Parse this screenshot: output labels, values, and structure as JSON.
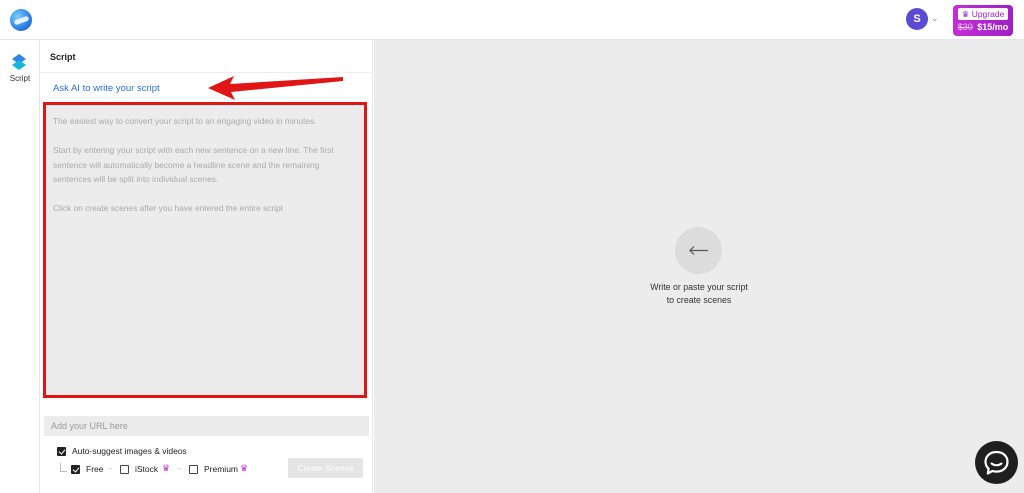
{
  "header": {
    "avatar_initial": "S",
    "upgrade": {
      "label": "Upgrade",
      "old_price": "$30",
      "new_price": "$15/mo",
      "color": "#b62fd0"
    }
  },
  "sidebar": {
    "items": [
      {
        "label": "Script",
        "icon": "script-icon"
      }
    ]
  },
  "script_panel": {
    "title": "Script",
    "ask_ai_link": "Ask AI to write your script",
    "placeholder_paragraphs": [
      "The easiest way to convert your script to an engaging video in minutes.",
      "Start by entering your script with each new sentence on a new line. The first\nsentence will automatically become a headline scene and the remaining\nsentences will be split into individual scenes.",
      "Click on create scenes after you have entered the entire script"
    ],
    "url_placeholder": "Add your URL here",
    "auto_suggest": {
      "label": "Auto-suggest images & videos",
      "checked": true
    },
    "sources": [
      {
        "label": "Free",
        "checked": true,
        "premium": false
      },
      {
        "label": "iStock",
        "checked": false,
        "premium": true
      },
      {
        "label": "Premium",
        "checked": false,
        "premium": true
      }
    ],
    "create_button": "Create Scenes"
  },
  "preview": {
    "empty_line1": "Write or paste your script",
    "empty_line2": "to create scenes",
    "empty_icon": "arrow-left-icon"
  },
  "annotation_color": "#e01616",
  "accent_color": "#2b6fd6"
}
